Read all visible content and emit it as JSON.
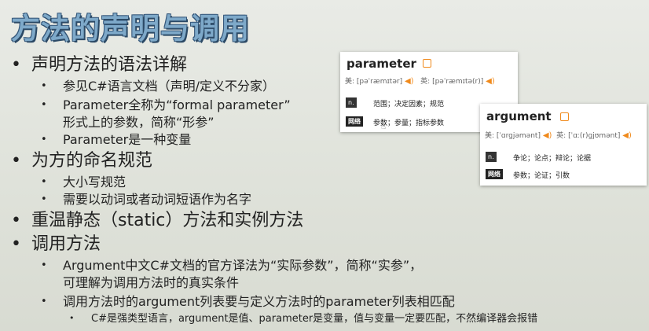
{
  "slide": {
    "title": "方法的声明与调用",
    "items": [
      {
        "text": "声明方法的语法详解",
        "sub": [
          {
            "text": "参见C#语言文档（声明/定义不分家）"
          },
          {
            "text": "Parameter全称为“formal parameter”",
            "cont": "形式上的参数，简称“形参”"
          },
          {
            "text": "Parameter是一种变量"
          }
        ]
      },
      {
        "text": "为方的命名规范",
        "sub": [
          {
            "text": "大小写规范"
          },
          {
            "text": "需要以动词或者动词短语作为名字"
          }
        ]
      },
      {
        "text": "重温静态（static）方法和实例方法",
        "sub": []
      },
      {
        "text": "调用方法",
        "sub": [
          {
            "text": "Argument中文C#文档的官方译法为“实际参数”，简称“实参”，",
            "cont": "可理解为调用方法时的真实条件"
          },
          {
            "text": "调用方法时的argument列表要与定义方法时的parameter列表相匹配",
            "sub": [
              {
                "text": "C#是强类型语言，argument是值、parameter是变量，值与变量一定要匹配，不然编译器会报错"
              }
            ]
          }
        ]
      }
    ]
  },
  "bullets": {
    "l1": "•",
    "l2": "•",
    "l3": "•"
  },
  "dict_parameter": {
    "word": "parameter",
    "us_label": "美:",
    "us_pron": "[pəˈræmɪtər]",
    "uk_label": "英:",
    "uk_pron": "[pəˈræmɪtə(r)]",
    "pos": "n.",
    "pos_def": "范围；决定因素；规范",
    "net_tag": "网络",
    "net_def": "参数；参量；指标参数"
  },
  "dict_argument": {
    "word": "argument",
    "us_label": "美:",
    "us_pron": "[ˈɑrgjəmənt]",
    "uk_label": "英:",
    "uk_pron": "[ˈɑː(r)gjʊmənt]",
    "pos": "n.",
    "pos_def": "争论；论点；辩论；论据",
    "net_tag": "网络",
    "net_def": "参数；论证；引数"
  },
  "colors": {
    "title": "#7ea9c9",
    "title_outline": "#2c4a66",
    "speaker": "#f08a1c",
    "background": "#e3e6de"
  },
  "icons": {
    "speaker": "speaker-icon",
    "edit": "edit-icon",
    "cursor": "hand-cursor-icon"
  }
}
